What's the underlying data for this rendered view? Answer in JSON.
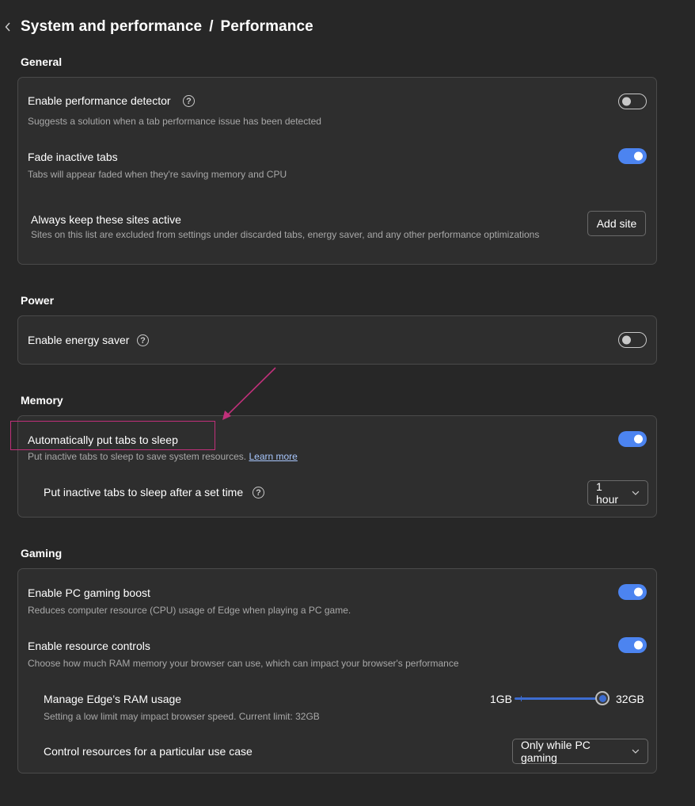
{
  "header": {
    "breadcrumb_parent": "System and performance",
    "separator": "/",
    "breadcrumb_current": "Performance"
  },
  "sections": {
    "general": {
      "title": "General",
      "performance_detector": {
        "label": "Enable performance detector",
        "desc": "Suggests a solution when a tab performance issue has been detected",
        "enabled": false
      },
      "fade_tabs": {
        "label": "Fade inactive tabs",
        "desc": "Tabs will appear faded when they're saving memory and CPU",
        "enabled": true
      },
      "keep_active": {
        "label": "Always keep these sites active",
        "desc": "Sites on this list are excluded from settings under discarded tabs, energy saver, and any other performance optimizations",
        "button": "Add site"
      }
    },
    "power": {
      "title": "Power",
      "energy_saver": {
        "label": "Enable energy saver",
        "enabled": false
      }
    },
    "memory": {
      "title": "Memory",
      "sleep_tabs": {
        "label": "Automatically put tabs to sleep",
        "desc": "Put inactive tabs to sleep to save system resources.",
        "link": "Learn more",
        "enabled": true
      },
      "sleep_after": {
        "label": "Put inactive tabs to sleep after a set time",
        "value": "1 hour"
      }
    },
    "gaming": {
      "title": "Gaming",
      "gaming_boost": {
        "label": "Enable PC gaming boost",
        "desc": "Reduces computer resource (CPU) usage of Edge when playing a PC game.",
        "enabled": true
      },
      "resource_controls": {
        "label": "Enable resource controls",
        "desc": "Choose how much RAM memory your browser can use, which can impact your browser's performance",
        "enabled": true
      },
      "ram_usage": {
        "label": "Manage Edge’s RAM usage",
        "desc": "Setting a low limit may impact browser speed. Current limit: 32GB",
        "min_label": "1GB",
        "max_label": "32GB",
        "value_fraction": 1.0
      },
      "use_case": {
        "label": "Control resources for a particular use case",
        "value": "Only while PC gaming"
      }
    }
  },
  "help_glyph": "?",
  "colors": {
    "accent": "#4c84f0",
    "annotation": "#c0307a",
    "background": "#272727",
    "card": "#2e2e2e"
  },
  "icons": {
    "back": "chevron-left-icon",
    "help": "help-circle-icon",
    "dropdown": "chevron-down-icon"
  }
}
